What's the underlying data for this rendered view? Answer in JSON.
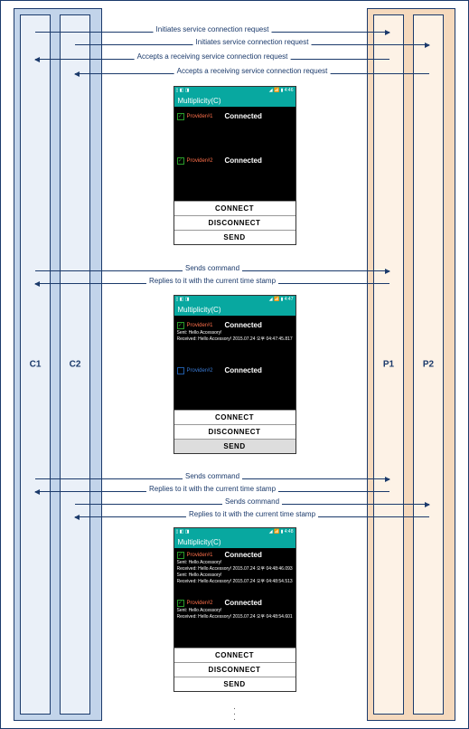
{
  "lanes": {
    "consumer": {
      "l1": "C1",
      "l2": "C2"
    },
    "provider": {
      "l1": "P1",
      "l2": "P2"
    }
  },
  "messages": {
    "m1": "Initiates service connection request",
    "m2": "Initiates service connection request",
    "m3": "Accepts a receiving service connection request",
    "m4": "Accepts a receiving service connection request",
    "m5": "Sends command",
    "m6": "Replies to it with the current time stamp",
    "m7": "Sends command",
    "m8": "Replies to it with the current time stamp",
    "m9": "Sends command",
    "m10": "Replies to it with the current time stamp"
  },
  "phone": {
    "status_left": "",
    "status_right": "",
    "app_title": "Multiplicity(C)",
    "provider1_label": "Provider#1",
    "provider2_label": "Provider#2",
    "connected": "Connected",
    "btn_connect": "CONNECT",
    "btn_disconnect": "DISCONNECT",
    "btn_send": "SEND",
    "log": {
      "p1_sent": "Sent: Hello Accessory!",
      "p1_recv": "Received: Hello Accessory! 2015.07.24 오후 04:47:45.817",
      "p3_a_recv": "Received: Hello Accessory! 2015.07.24 오후 04:48:46.093",
      "p3_a_sent": "Sent: Hello Accessory!",
      "p3_a_recv2": "Received: Hello Accessory! 2015.07.24 오후 04:48:54.513",
      "p3_b_sent": "Sent: Hello Accessory!",
      "p3_b_recv": "Received: Hello Accessory! 2015.07.24 오후 04:48:54.601"
    }
  },
  "chart_data": {
    "type": "sequence",
    "participants": [
      "C1",
      "C2",
      "P1",
      "P2"
    ],
    "messages": [
      {
        "from": "C1",
        "to": "P1",
        "text": "Initiates service connection request"
      },
      {
        "from": "C2",
        "to": "P2",
        "text": "Initiates service connection request"
      },
      {
        "from": "P1",
        "to": "C1",
        "text": "Accepts a receiving service connection request"
      },
      {
        "from": "P2",
        "to": "C2",
        "text": "Accepts a receiving service connection request"
      },
      {
        "from": "C1",
        "to": "P1",
        "text": "Sends command"
      },
      {
        "from": "P1",
        "to": "C1",
        "text": "Replies to it with the current time stamp"
      },
      {
        "from": "C1",
        "to": "P1",
        "text": "Sends command"
      },
      {
        "from": "P1",
        "to": "C1",
        "text": "Replies to it with the current time stamp"
      },
      {
        "from": "C2",
        "to": "P2",
        "text": "Sends command"
      },
      {
        "from": "P2",
        "to": "C2",
        "text": "Replies to it with the current time stamp"
      }
    ],
    "screenshots": [
      {
        "state": "both providers connected, no log"
      },
      {
        "state": "provider1 connected with sent+received log, provider2 connected (unchecked)"
      },
      {
        "state": "both providers connected, both have sent+received logs"
      }
    ]
  }
}
